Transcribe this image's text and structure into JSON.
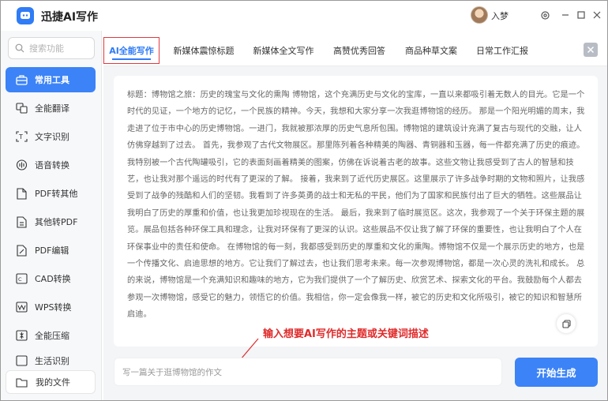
{
  "app": {
    "title": "迅捷AI写作",
    "user_name": "入梦",
    "window_buttons": [
      "settings-icon",
      "minimize-icon",
      "maximize-icon",
      "close-icon"
    ]
  },
  "sidebar": {
    "search_placeholder": "搜索功能",
    "items": [
      {
        "label": "常用工具",
        "icon": "toolbox-icon",
        "active": true
      },
      {
        "label": "全能翻译",
        "icon": "translate-icon"
      },
      {
        "label": "文字识别",
        "icon": "text-recognition-icon"
      },
      {
        "label": "语音转换",
        "icon": "voice-icon"
      },
      {
        "label": "PDF转其他",
        "icon": "pdf-export-icon"
      },
      {
        "label": "其他转PDF",
        "icon": "pdf-import-icon"
      },
      {
        "label": "PDF编辑",
        "icon": "pdf-edit-icon"
      },
      {
        "label": "CAD转换",
        "icon": "cad-icon"
      },
      {
        "label": "WPS转换",
        "icon": "wps-icon"
      },
      {
        "label": "全能压缩",
        "icon": "compress-icon"
      },
      {
        "label": "生活识别",
        "icon": "life-recognition-icon"
      }
    ],
    "footer_label": "我的文件"
  },
  "tabs": [
    {
      "label": "AI全能写作",
      "active": true
    },
    {
      "label": "新媒体震惊标题"
    },
    {
      "label": "新媒体全文写作"
    },
    {
      "label": "高赞优秀回答"
    },
    {
      "label": "商品种草文案"
    },
    {
      "label": "日常工作汇报"
    }
  ],
  "article": {
    "text": "标题：博物馆之旅：历史的瑰宝与文化的熏陶 博物馆，这个充满历史与文化的宝库，一直以来都吸引着无数人的目光。它是一个时代的见证，一个地方的记忆，一个民族的精神。今天，我想和大家分享一次我逛博物馆的经历。 那是一个阳光明媚的周末，我走进了位于市中心的历史博物馆。一进门，我就被那浓厚的历史气息所包围。博物馆的建筑设计充满了复古与现代的交融，让人仿佛穿越到了过去。 首先，我参观了古代文物展区。那里陈列着各种精美的陶器、青铜器和玉器，每一件都充满了历史的痕迹。我特别被一个古代陶罐吸引，它的表面刻画着精美的图案，仿佛在诉说着古老的故事。这些文物让我感受到了古人的智慧和技艺，也让我对那个遥远的时代有了更深的了解。 接着，我来到了近代历史展区。这里展示了许多战争时期的文物和照片，让我感受到了战争的残酷和人们的坚韧。我看到了许多英勇的战士和无私的平民，他们为了国家和民族付出了巨大的牺牲。这些展品让我明白了历史的厚重和价值，也让我更加珍视现在的生活。 最后，我来到了临时展览区。这次，我参观了一个关于环保主题的展览。展品包括各种环保工具和理念，让我对环保有了更深的认识。这些展品不仅让我了解了环保的重要性，也让我明白了个人在环保事业中的责任和使命。 在博物馆的每一刻，我都感受到历史的厚重和文化的熏陶。博物馆不仅是一个展示历史的地方，也是一个传播文化、启迪思想的地方。它让我们了解过去，也让我们思考未来。每一次参观博物馆，都是一次心灵的洗礼和成长。 总的来说，博物馆是一个充满知识和趣味的地方，它为我们提供了一个了解历史、欣赏艺术、探索文化的平台。我鼓励每个人都去参观一次博物馆，感受它的魅力，领悟它的价值。我相信，你一定会像我一样，被它的历史和文化所吸引，被它的知识和智慧所启迪。"
  },
  "annotation": "输入想要AI写作的主题或关键词描述",
  "prompt": {
    "value": "写一篇关于逛博物馆的作文"
  },
  "generate_button": "开始生成",
  "colors": {
    "accent": "#3b83f7",
    "annotation_red": "#e02a2a",
    "tab_highlight_border": "#e0393e"
  }
}
